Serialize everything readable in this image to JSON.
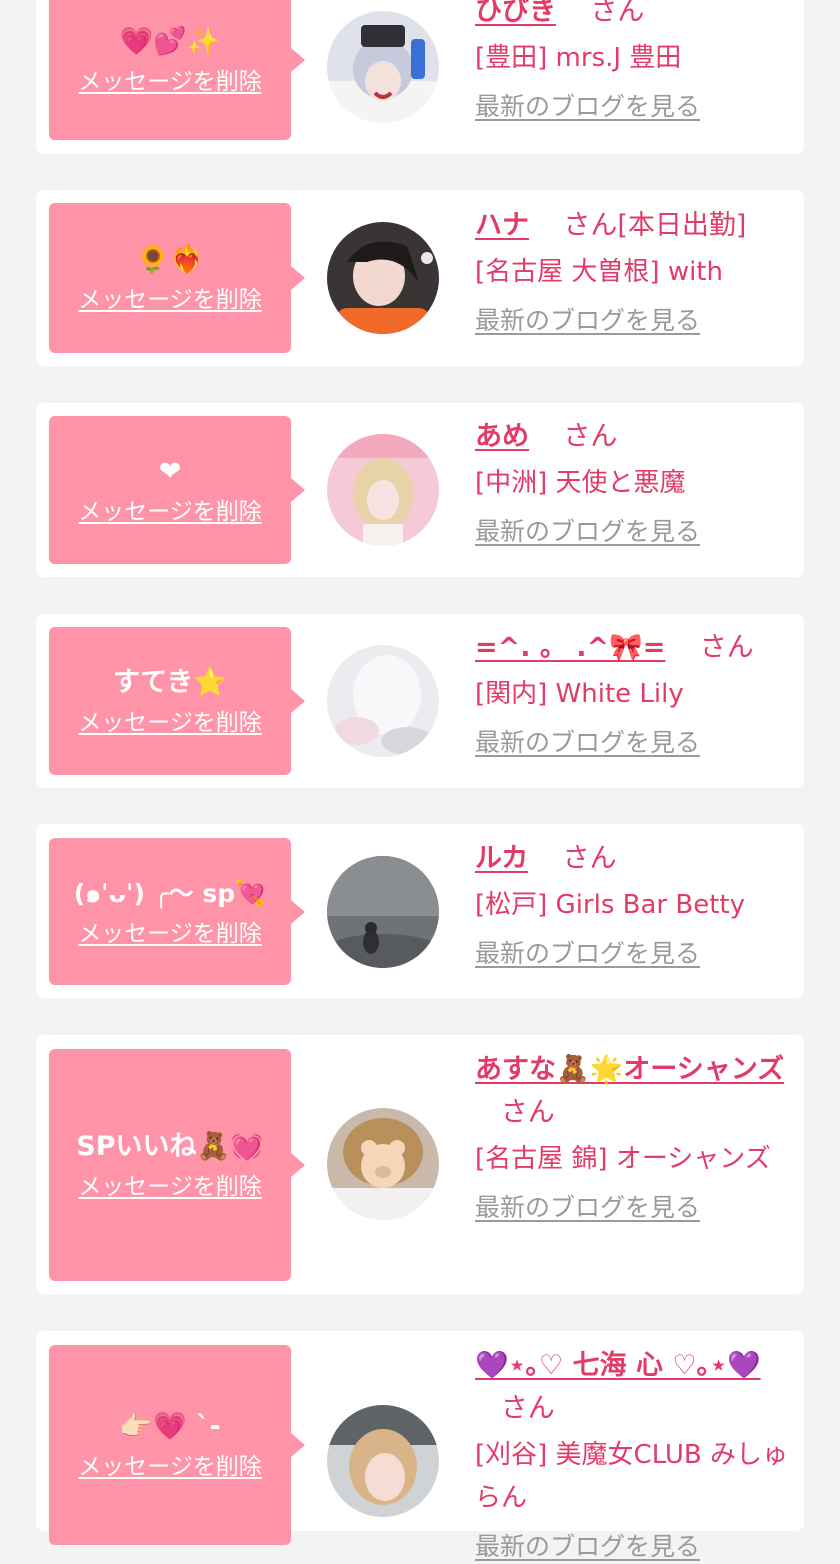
{
  "delete_label": "メッセージを削除",
  "blog_label": "最新のブログを見る",
  "san_label": "さん",
  "colors": {
    "background": "#f3f3f3",
    "card": "#ffffff",
    "bubble": "#ff94a8",
    "accent_text": "#e33b69",
    "link_gray": "#9a9a9a"
  },
  "cards": [
    {
      "message": "💗💕✨",
      "name": "ひびき",
      "name_suffix": "",
      "shop": "[豊田] mrs.J 豊田"
    },
    {
      "message": "🌻❤️‍🔥",
      "name": "ハナ",
      "name_suffix": "[本日出勤]",
      "shop": "[名古屋 大曽根] with"
    },
    {
      "message": "❤",
      "name": "あめ",
      "name_suffix": "",
      "shop": "[中洲] 天使と悪魔"
    },
    {
      "message": "すてき⭐",
      "name": "=^. 。 .^🎀=",
      "name_suffix": "",
      "shop": "[関内] White Lily"
    },
    {
      "message": "(๑ˈᴗˈ) ╭〜 sp💘",
      "name": "ルカ",
      "name_suffix": "",
      "shop": "[松戸] Girls Bar Betty"
    },
    {
      "message": "SPいいね🧸💓",
      "name": "あすな🧸🌟オーシャンズ",
      "name_suffix": "",
      "shop": "[名古屋 錦] オーシャンズ"
    },
    {
      "message": "👉🏻💗 ˋ-",
      "name": "💜⋆｡♡ 七海 心 ♡｡⋆💜",
      "name_suffix": "",
      "shop": "[刈谷] 美魔女CLUB みしゅらん"
    }
  ]
}
